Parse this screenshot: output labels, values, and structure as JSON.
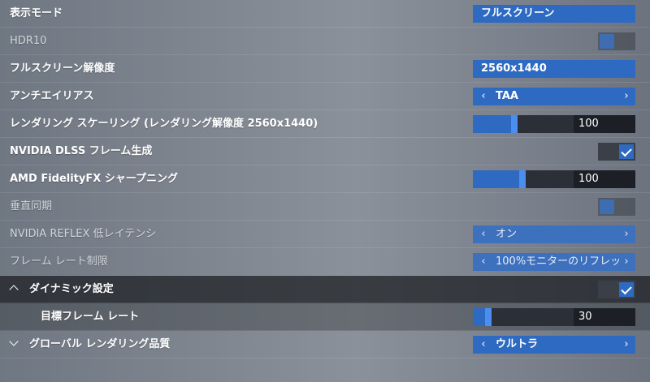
{
  "settings": {
    "display_mode": {
      "label": "表示モード",
      "value": "フルスクリーン"
    },
    "hdr10": {
      "label": "HDR10",
      "state": "off"
    },
    "fullscreen_resolution": {
      "label": "フルスクリーン解像度",
      "value": "2560x1440"
    },
    "anti_aliasing": {
      "label": "アンチエイリアス",
      "value": "TAA"
    },
    "render_scaling": {
      "label": "レンダリング スケーリング (レンダリング解像度 2560x1440)",
      "value": "100",
      "level_percent": 41
    },
    "dlss_frame_gen": {
      "label": "NVIDIA DLSS フレーム生成",
      "state": "on"
    },
    "fidelityfx_sharpening": {
      "label": "AMD FidelityFX シャープニング",
      "value": "100",
      "level_percent": 49
    },
    "vsync": {
      "label": "垂直同期",
      "state": "off"
    },
    "reflex": {
      "label": "NVIDIA REFLEX 低レイテンシ",
      "value": "オン"
    },
    "frame_rate_limit": {
      "label": "フレーム レート制限",
      "value": "100%モニターのリフレッシュ"
    },
    "dynamic_settings": {
      "label": "ダイナミック設定",
      "state": "on"
    },
    "target_frame_rate": {
      "label": "目標フレーム レート",
      "value": "30",
      "level_percent": 15
    },
    "global_render_quality": {
      "label": "グローバル レンダリング品質",
      "value": "ウルトラ"
    }
  },
  "icons": {
    "arrow_left": "‹",
    "arrow_right": "›"
  },
  "colors": {
    "accent": "#2f6ac2",
    "thumb": "#4b8ef0",
    "panel_dark": "#23282f"
  }
}
